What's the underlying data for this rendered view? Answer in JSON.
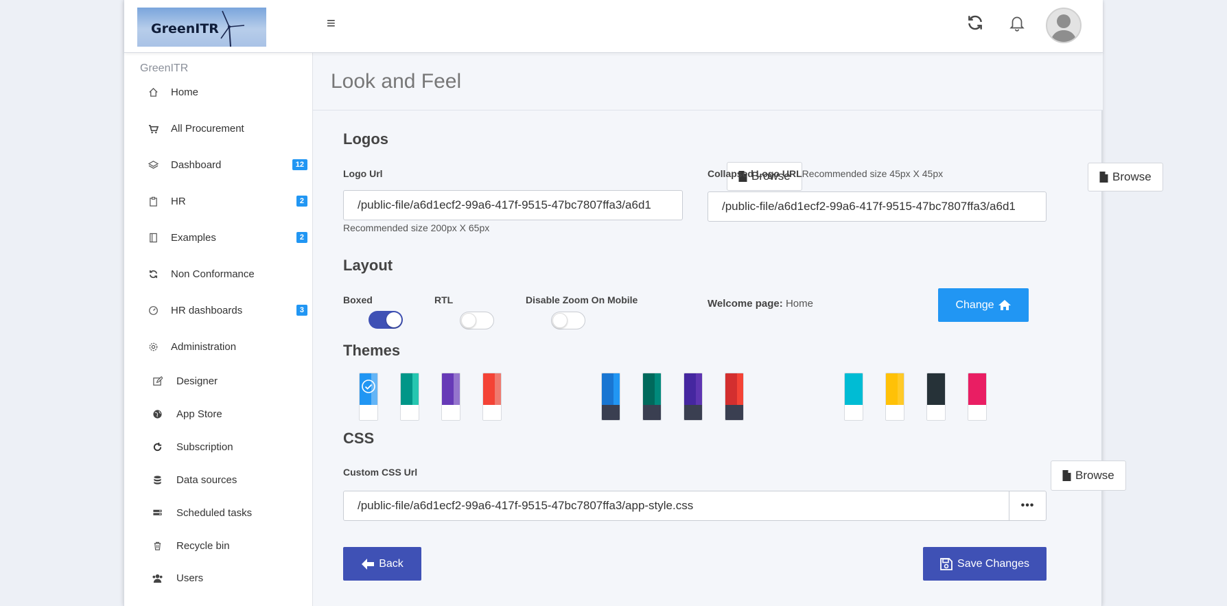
{
  "header": {
    "logo_text": "GreenITR",
    "menu_icon": "hamburger-icon",
    "refresh_icon": "refresh-icon",
    "bell_icon": "bell-icon",
    "avatar_icon": "user-avatar-icon"
  },
  "sidebar": {
    "title": "GreenITR",
    "items": [
      {
        "label": "Home",
        "icon": "home-icon"
      },
      {
        "label": "All Procurement",
        "icon": "cart-icon"
      },
      {
        "label": "Dashboard",
        "icon": "layers-icon",
        "badge": "12"
      },
      {
        "label": "HR",
        "icon": "clipboard-icon",
        "badge": "2"
      },
      {
        "label": "Examples",
        "icon": "book-icon",
        "badge": "2"
      },
      {
        "label": "Non Conformance",
        "icon": "sync-icon"
      },
      {
        "label": "HR dashboards",
        "icon": "gauge-icon",
        "badge": "3"
      },
      {
        "label": "Administration",
        "icon": "gear-icon"
      },
      {
        "label": "Designer",
        "icon": "edit-icon"
      },
      {
        "label": "App Store",
        "icon": "globe-icon"
      },
      {
        "label": "Subscription",
        "icon": "redo-icon"
      },
      {
        "label": "Data sources",
        "icon": "database-icon"
      },
      {
        "label": "Scheduled tasks",
        "icon": "server-icon"
      },
      {
        "label": "Recycle bin",
        "icon": "trash-icon"
      },
      {
        "label": "Users",
        "icon": "users-icon"
      }
    ]
  },
  "page": {
    "title": "Look and Feel"
  },
  "logos": {
    "heading": "Logos",
    "logo_url_label": "Logo Url",
    "logo_url_value": "/public-file/a6d1ecf2-99a6-417f-9515-47bc7807ffa3/a6d1",
    "logo_hint": "Recommended size 200px X 65px",
    "browse_label": "Browse",
    "collapsed_label": "Collapsed Logo URL",
    "collapsed_hint": "Recommended size 45px X 45px",
    "collapsed_value": "/public-file/a6d1ecf2-99a6-417f-9515-47bc7807ffa3/a6d1"
  },
  "layout": {
    "heading": "Layout",
    "boxed_label": "Boxed",
    "boxed_on": true,
    "rtl_label": "RTL",
    "rtl_on": false,
    "zoom_label": "Disable Zoom On Mobile",
    "zoom_on": false,
    "welcome_label": "Welcome page:",
    "welcome_value": "Home",
    "change_label": "Change"
  },
  "themes": {
    "heading": "Themes",
    "selected_index": 0,
    "swatches": [
      {
        "top": "#2196f3",
        "stripe": "#64b5f6",
        "bottom": "#ffffff"
      },
      {
        "top": "#009688",
        "stripe": "#26c6b0",
        "bottom": "#ffffff"
      },
      {
        "top": "#673ab7",
        "stripe": "#9575cd",
        "bottom": "#ffffff"
      },
      {
        "top": "#f44336",
        "stripe": "#ef7a70",
        "bottom": "#ffffff"
      },
      {
        "top": "#1976d2",
        "stripe": "#2196f3",
        "bottom": "#3a3f51"
      },
      {
        "top": "#00695c",
        "stripe": "#00897b",
        "bottom": "#3a3f51"
      },
      {
        "top": "#4527a0",
        "stripe": "#5e35b1",
        "bottom": "#3a3f51"
      },
      {
        "top": "#d32f2f",
        "stripe": "#f44336",
        "bottom": "#3a3f51"
      },
      {
        "top": "#00bcd4",
        "stripe": "#00bcd4",
        "bottom": "#ffffff"
      },
      {
        "top": "#ffc107",
        "stripe": "#ffca28",
        "bottom": "#ffffff"
      },
      {
        "top": "#263238",
        "stripe": "#263238",
        "bottom": "#ffffff"
      },
      {
        "top": "#e91e63",
        "stripe": "#e91e63",
        "bottom": "#ffffff"
      }
    ]
  },
  "css": {
    "heading": "CSS",
    "custom_label": "Custom CSS Url",
    "custom_value": "/public-file/a6d1ecf2-99a6-417f-9515-47bc7807ffa3/app-style.css",
    "browse_label": "Browse",
    "more_label": "•••"
  },
  "actions": {
    "back_label": "Back",
    "save_label": "Save Changes"
  },
  "colors": {
    "primary": "#3f51b5",
    "accent": "#2196f3"
  }
}
